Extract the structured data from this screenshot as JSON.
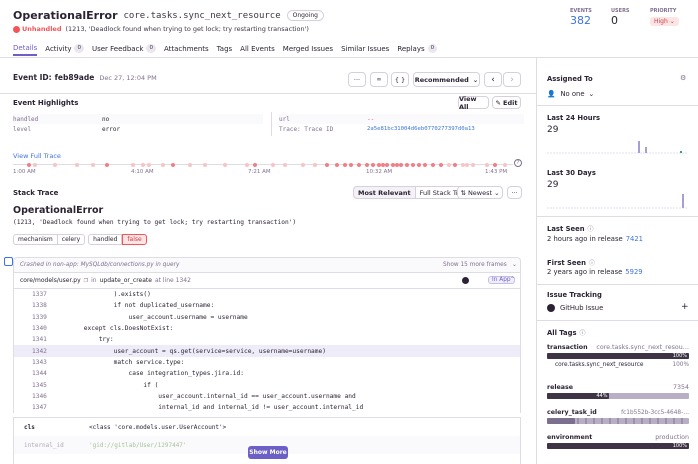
{
  "header": {
    "error_type": "OperationalError",
    "culprit": "core.tasks.sync_next_resource",
    "status_badge": "Ongoing",
    "unhandled": "Unhandled",
    "message": "(1213, 'Deadlock found when trying to get lock; try restarting transaction')",
    "stats": [
      {
        "label": "EVENTS",
        "value": "382"
      },
      {
        "label": "USERS",
        "value": "0"
      },
      {
        "label": "PRIORITY",
        "value": "High"
      }
    ],
    "priority_chevron": "⌄"
  },
  "tabs": [
    {
      "label": "Details",
      "count": ""
    },
    {
      "label": "Activity",
      "count": "0"
    },
    {
      "label": "User Feedback",
      "count": "0"
    },
    {
      "label": "Attachments",
      "count": ""
    },
    {
      "label": "Tags",
      "count": ""
    },
    {
      "label": "All Events",
      "count": ""
    },
    {
      "label": "Merged Issues",
      "count": ""
    },
    {
      "label": "Similar Issues",
      "count": ""
    },
    {
      "label": "Replays",
      "count": "0"
    }
  ],
  "event": {
    "id_label": "Event ID:",
    "id": "feb89ade",
    "date": "Dec 27, 12:04 PM",
    "recommended": "Recommended",
    "more": "···",
    "link_icon": "🔗",
    "json_icon": "{ }",
    "prev": "‹",
    "next": "›"
  },
  "highlights": {
    "title": "Event Highlights",
    "view_all": "View All",
    "edit": "Edit",
    "left": [
      {
        "k": "handled",
        "v": "no"
      },
      {
        "k": "level",
        "v": "error"
      }
    ],
    "right": [
      {
        "k": "url",
        "v": "--"
      },
      {
        "k": "Trace: Trace ID",
        "v": "2a5e81bc31004d6eb0770277397d0a13"
      }
    ]
  },
  "timeline": {
    "view_full": "View Full Trace",
    "labels": [
      "1:00 AM",
      "4:10 AM",
      "7:21 AM",
      "10:32 AM",
      "1:43 PM"
    ],
    "help": "?"
  },
  "stack": {
    "title": "Stack Trace",
    "most_relevant": "Most Relevant",
    "full_stack": "Full Stack Trace",
    "newest": "Newest",
    "more": "···",
    "exception": "OperationalError",
    "exception_msg": "(1213, 'Deadlock found when trying to get lock; try restarting transaction')",
    "mech_tags": [
      "mechanism",
      "celery",
      "handled",
      "false"
    ],
    "crashed": "Crashed in non-app: MySQLdb/connections.py in query",
    "show_more_frames": "Show 15 more frames",
    "frame_path": "core/models/user.py",
    "frame_in": "in",
    "frame_func": "update_or_create",
    "frame_line": "at line 1342",
    "in_app": "In App",
    "lines": [
      {
        "n": "1337",
        "code": "                ).exists()"
      },
      {
        "n": "1338",
        "code": "                if not duplicated_username:"
      },
      {
        "n": "1339",
        "code": "                    user_account.username = username"
      },
      {
        "n": "1340",
        "code": "        except cls.DoesNotExist:"
      },
      {
        "n": "1341",
        "code": "            try:"
      },
      {
        "n": "1342",
        "code": "                user_account = qs.get(service=service, username=username)"
      },
      {
        "n": "1343",
        "code": "                match service.type:"
      },
      {
        "n": "1344",
        "code": "                    case integration_types.jira.id:"
      },
      {
        "n": "1345",
        "code": "                        if ("
      },
      {
        "n": "1346",
        "code": "                            user_account.internal_id == user_account.username and"
      },
      {
        "n": "1347",
        "code": "                            internal_id and internal_id != user_account.internal_id"
      }
    ],
    "vars": [
      {
        "k": "cls",
        "v": "<class 'core.models.user.UserAccount'>"
      },
      {
        "k": "internal_id",
        "v": "'gid://gitlab/User/1297447'"
      }
    ],
    "show_more": "Show More"
  },
  "sidebar": {
    "assigned_to": "Assigned To",
    "gear": "⚙",
    "none": "No one",
    "last24_title": "Last 24 Hours",
    "last24_value": "29",
    "last30_title": "Last 30 Days",
    "last30_value": "29",
    "last_seen_title": "Last Seen",
    "last_seen_text": "2 hours ago in release",
    "last_seen_release": "7421",
    "first_seen_title": "First Seen",
    "first_seen_text": "2 years ago in release",
    "first_seen_release": "5929",
    "issue_tracking": "Issue Tracking",
    "github_issue": "GitHub Issue",
    "plus": "+",
    "all_tags": "All Tags",
    "tags": [
      {
        "name": "transaction",
        "value": "core.tasks.sync_next_resou…",
        "bar_label": "100%",
        "sub": "core.tasks.sync_next_resource",
        "sub_pct": "100%",
        "fill": 1.0
      },
      {
        "name": "release",
        "value": "7354",
        "bar_label": "44%",
        "fill": 0.44
      },
      {
        "name": "celery_task_id",
        "value": "fc1b552b-3cc5-4648-…",
        "bar_label": "",
        "fill": 0.2
      },
      {
        "name": "environment",
        "value": "production",
        "bar_label": "100%",
        "fill": 1.0
      }
    ]
  },
  "colors": {
    "accent": "#6c5fc7",
    "error": "#f55459",
    "muted": "#80708f",
    "border": "#e0dce5"
  }
}
